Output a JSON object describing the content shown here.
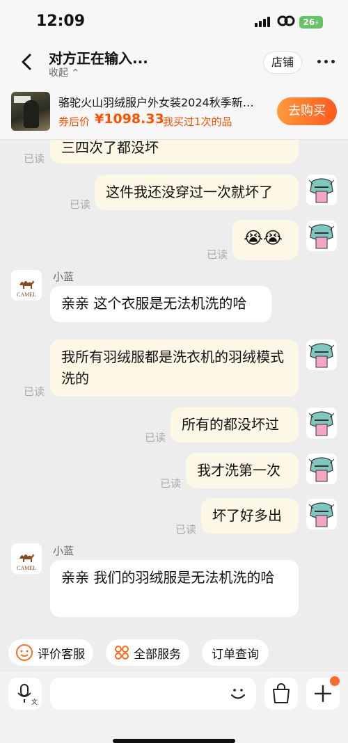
{
  "status_bar": {
    "time": "12:09",
    "battery": "26"
  },
  "header": {
    "title": "对方正在输入...",
    "collapse_label": "收起",
    "shop_label": "店铺"
  },
  "product": {
    "name": "骆驼火山羽绒服户外女装2024秋季新…",
    "price_label": "券后价",
    "price": "¥1098.33",
    "bought_note": "我买过1次的品",
    "buy_button": "去购买"
  },
  "messages": [
    {
      "from": "me",
      "text": "三四次了都没坏",
      "status": "已读"
    },
    {
      "from": "me",
      "text": "这件我还没穿过一次就坏了",
      "status": "已读"
    },
    {
      "from": "me",
      "text": "😭😭",
      "status": "已读"
    },
    {
      "from": "agent",
      "sender": "小蓝",
      "text": "亲亲 这个衣服是无法机洗的哈"
    },
    {
      "from": "me",
      "text": "我所有羽绒服都是洗衣机的羽绒模式洗的",
      "status": "已读"
    },
    {
      "from": "me",
      "text": "所有的都没坏过",
      "status": "已读"
    },
    {
      "from": "me",
      "text": "我才洗第一次",
      "status": "已读"
    },
    {
      "from": "me",
      "text": "坏了好多出",
      "status": "已读"
    },
    {
      "from": "agent",
      "sender": "小蓝",
      "text": "亲亲 我们的羽绒服是无法机洗的哈"
    }
  ],
  "agent_logo_text": "CAMEL",
  "quick_actions": [
    "评价客服",
    "全部服务",
    "订单查询"
  ],
  "icons": [
    "back-arrow-icon",
    "more-icon",
    "voice-icon",
    "emoji-icon",
    "bag-icon",
    "plus-icon"
  ],
  "colors": {
    "accent": "#ff5000",
    "sent_bubble": "#fdf7e6"
  }
}
